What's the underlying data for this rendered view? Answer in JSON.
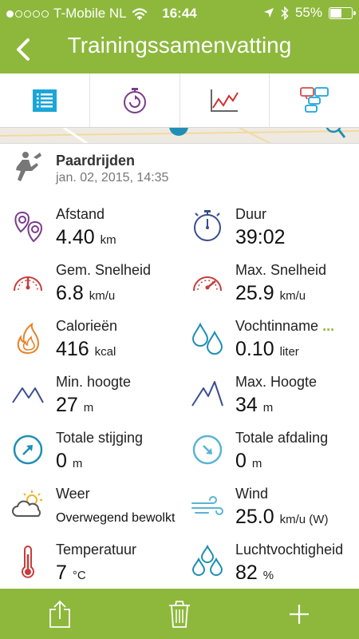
{
  "status_bar": {
    "carrier": "T-Mobile NL",
    "time": "16:44",
    "battery": "55%",
    "battery_level": 0.55,
    "signal_bars_filled": 1,
    "signal_bars_total": 5
  },
  "header": {
    "title": "Trainingssamenvatting"
  },
  "tabs": [
    {
      "icon": "list-icon",
      "active": true
    },
    {
      "icon": "stopwatch-icon"
    },
    {
      "icon": "line-chart-icon"
    },
    {
      "icon": "comments-icon"
    }
  ],
  "activity": {
    "name": "Paardrijden",
    "date": "jan. 02, 2015, 14:35"
  },
  "stats": {
    "afstand": {
      "label": "Afstand",
      "value": "4.40",
      "unit": "km"
    },
    "duur": {
      "label": "Duur",
      "value": "39:02"
    },
    "gem_snelheid": {
      "label": "Gem. Snelheid",
      "value": "6.8",
      "unit": "km/u"
    },
    "max_snelheid": {
      "label": "Max. Snelheid",
      "value": "25.9",
      "unit": "km/u"
    },
    "calorieen": {
      "label": "Calorieën",
      "value": "416",
      "unit": "kcal"
    },
    "vochtinname": {
      "label": "Vochtinname",
      "more": "...",
      "value": "0.10",
      "unit": "liter"
    },
    "min_hoogte": {
      "label": "Min. hoogte",
      "value": "27",
      "unit": "m"
    },
    "max_hoogte": {
      "label": "Max. Hoogte",
      "value": "34",
      "unit": "m"
    },
    "totale_stijging": {
      "label": "Totale stijging",
      "value": "0",
      "unit": "m"
    },
    "totale_afdaling": {
      "label": "Totale afdaling",
      "value": "0",
      "unit": "m"
    },
    "weer": {
      "label": "Weer",
      "value": "Overwegend bewolkt"
    },
    "wind": {
      "label": "Wind",
      "value": "25.0",
      "unit": "km/u (W)"
    },
    "temperatuur": {
      "label": "Temperatuur",
      "value": "7",
      "unit": "°C"
    },
    "luchtvochtigheid": {
      "label": "Luchtvochtigheid",
      "value": "82",
      "unit": "%"
    }
  },
  "bottom_bar": [
    {
      "icon": "share-icon"
    },
    {
      "icon": "trash-icon"
    },
    {
      "icon": "add-icon"
    }
  ],
  "colors": {
    "brand_green": "#8db83c",
    "tab_blue": "#1aa6d9",
    "purple": "#7a3c8c",
    "navy": "#3a4d8f",
    "red": "#c73c3c",
    "orange": "#e8822a",
    "teal": "#1f8fb5",
    "light_blue": "#5ab4d6"
  }
}
